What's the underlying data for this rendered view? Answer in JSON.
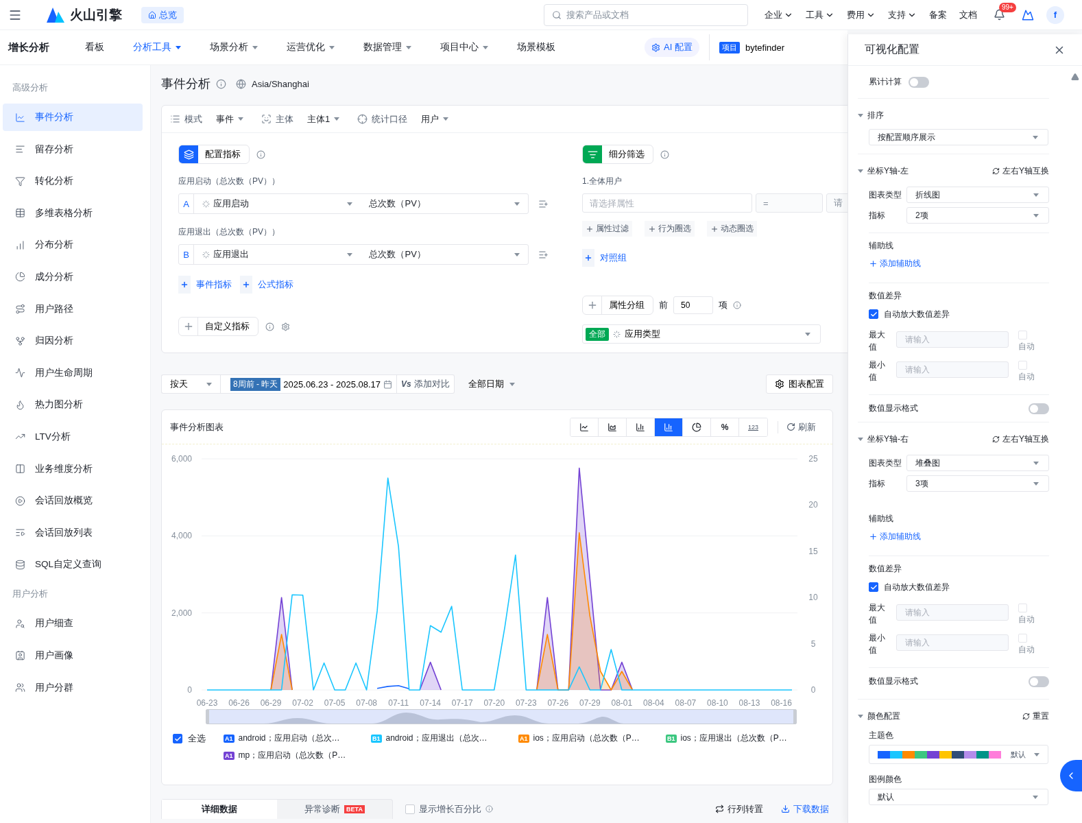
{
  "header": {
    "brand": "火山引擎",
    "home": "总览",
    "search_placeholder": "搜索产品或文档",
    "menus": [
      {
        "label": "企业",
        "has_menu": true
      },
      {
        "label": "工具",
        "has_menu": true
      },
      {
        "label": "费用",
        "has_menu": true
      },
      {
        "label": "支持",
        "has_menu": true
      },
      {
        "label": "备案",
        "has_menu": false
      },
      {
        "label": "文档",
        "has_menu": false
      }
    ],
    "badge": "99+",
    "avatar": "f"
  },
  "nav": {
    "title": "增长分析",
    "items": [
      {
        "label": "看板",
        "has_menu": false,
        "selected": false
      },
      {
        "label": "分析工具",
        "has_menu": true,
        "selected": true
      },
      {
        "label": "场景分析",
        "has_menu": true,
        "selected": false
      },
      {
        "label": "运营优化",
        "has_menu": true,
        "selected": false
      },
      {
        "label": "数据管理",
        "has_menu": true,
        "selected": false
      },
      {
        "label": "项目中心",
        "has_menu": true,
        "selected": false
      },
      {
        "label": "场景模板",
        "has_menu": false,
        "selected": false
      }
    ],
    "ai": "AI 配置",
    "project_tag": "项目",
    "project": "bytefinder"
  },
  "sidebar": {
    "sections": [
      {
        "title": "高级分析",
        "items": [
          {
            "label": "事件分析",
            "selected": true
          },
          {
            "label": "留存分析",
            "selected": false
          },
          {
            "label": "转化分析",
            "selected": false
          },
          {
            "label": "多维表格分析",
            "selected": false
          },
          {
            "label": "分布分析",
            "selected": false
          },
          {
            "label": "成分分析",
            "selected": false
          },
          {
            "label": "用户路径",
            "selected": false
          },
          {
            "label": "归因分析",
            "selected": false
          },
          {
            "label": "用户生命周期",
            "selected": false
          },
          {
            "label": "热力图分析",
            "selected": false
          },
          {
            "label": "LTV分析",
            "selected": false
          },
          {
            "label": "业务维度分析",
            "selected": false
          },
          {
            "label": "会话回放概览",
            "selected": false
          },
          {
            "label": "会话回放列表",
            "selected": false
          },
          {
            "label": "SQL自定义查询",
            "selected": false
          }
        ]
      },
      {
        "title": "用户分析",
        "items": [
          {
            "label": "用户细查",
            "selected": false
          },
          {
            "label": "用户画像",
            "selected": false
          },
          {
            "label": "用户分群",
            "selected": false
          }
        ]
      }
    ]
  },
  "page": {
    "title": "事件分析",
    "timezone": "Asia/Shanghai"
  },
  "query_bar": [
    {
      "label": "模式",
      "value": "事件"
    },
    {
      "label": "主体",
      "value": "主体1"
    },
    {
      "label": "统计口径",
      "value": "用户"
    }
  ],
  "metrics": {
    "title": "配置指标",
    "items": [
      {
        "caption": "应用启动（总次数（PV））",
        "letter": "A",
        "event": "应用启动",
        "measure": "总次数（PV）"
      },
      {
        "caption": "应用退出（总次数（PV））",
        "letter": "B",
        "event": "应用退出",
        "measure": "总次数（PV）"
      }
    ],
    "add_buttons": [
      "事件指标",
      "公式指标"
    ],
    "custom": "自定义指标"
  },
  "filter": {
    "title": "细分筛选",
    "group": "1.全体用户",
    "property_placeholder": "请选择属性",
    "operator": "=",
    "value_cut": "请",
    "actions": [
      "属性过滤",
      "行为圈选",
      "动态圈选"
    ],
    "compare": "对照组",
    "group_by": "属性分组",
    "top_prefix": "前",
    "top_value": "50",
    "top_suffix": "项",
    "tag": "全部",
    "group_value": "应用类型"
  },
  "date_bar": {
    "granularity": "按天",
    "range_tag": "8周前 - 昨天",
    "range": "2025.06.23 - 2025.08.17",
    "compare_mark": "Vs",
    "compare": "添加对比",
    "period": "全部日期",
    "chart_config": "图表配置"
  },
  "chart_card": {
    "title": "事件分析图表",
    "types": [
      {
        "kind": "line",
        "selected": false
      },
      {
        "kind": "area",
        "selected": false
      },
      {
        "kind": "bar",
        "selected": false
      },
      {
        "kind": "combo",
        "selected": true
      },
      {
        "kind": "pie",
        "selected": false
      },
      {
        "kind": "text",
        "label": "%",
        "selected": false
      },
      {
        "kind": "number",
        "label": "123",
        "selected": false
      }
    ],
    "refresh": "刷新",
    "chart_data": {
      "type": "line",
      "categories": [
        "06-23",
        null,
        null,
        "06-26",
        null,
        null,
        "06-29",
        null,
        null,
        "07-02",
        null,
        null,
        "07-05",
        null,
        null,
        "07-08",
        null,
        null,
        "07-11",
        null,
        null,
        "07-14",
        null,
        null,
        "07-17",
        null,
        null,
        "07-20",
        null,
        null,
        "07-23",
        null,
        null,
        "07-26",
        null,
        null,
        "07-29",
        null,
        null,
        "08-01",
        null,
        null,
        "08-04",
        null,
        null,
        "08-07",
        null,
        null,
        "08-10",
        null,
        null,
        "08-13",
        null,
        null,
        "08-16",
        null
      ],
      "ylim": [
        0,
        6000
      ],
      "yticks": [
        {
          "value": 0,
          "label": "0"
        },
        {
          "value": 2000,
          "label": "2,000"
        },
        {
          "value": 4000,
          "label": "4,000"
        },
        {
          "value": 6000,
          "label": "6,000"
        }
      ],
      "y2lim": [
        0,
        25
      ],
      "y2ticks": [
        0,
        5,
        10,
        15,
        20,
        25
      ],
      "series": [
        {
          "name": "android；应用启动（总次…",
          "color": "#1664ff",
          "values": [
            null,
            null,
            null,
            null,
            null,
            null,
            null,
            null,
            null,
            null,
            null,
            null,
            null,
            null,
            null,
            null,
            40,
            90,
            110,
            30,
            null,
            null,
            null,
            null,
            null,
            null,
            null,
            null,
            null,
            null,
            null,
            null,
            null,
            null,
            null,
            null,
            null,
            null,
            null,
            null,
            null,
            null,
            null,
            null,
            null,
            null,
            null,
            null,
            null,
            null,
            null,
            null,
            null,
            null,
            null,
            null
          ]
        },
        {
          "name": "android；应用退出（总次…",
          "color": "#1ac6ff",
          "values": [
            0,
            0,
            0,
            0,
            0,
            0,
            0,
            0,
            2470,
            2460,
            0,
            700,
            0,
            0,
            700,
            0,
            2050,
            5500,
            3720,
            0,
            0,
            1670,
            1500,
            2170,
            0,
            0,
            0,
            0,
            1640,
            3500,
            0,
            0,
            0,
            0,
            0,
            600,
            0,
            0,
            1050,
            0,
            0,
            0,
            0,
            0,
            0,
            0,
            0,
            0,
            0,
            0,
            0,
            0,
            0,
            0,
            0,
            0
          ]
        },
        {
          "name": "ios；应用启动（总次数（P…",
          "color": "#ff8a00",
          "axis": "y2",
          "values": [
            null,
            null,
            null,
            null,
            null,
            null,
            0,
            6,
            0,
            null,
            null,
            null,
            null,
            null,
            null,
            null,
            null,
            null,
            null,
            null,
            null,
            null,
            null,
            null,
            null,
            null,
            null,
            null,
            null,
            null,
            null,
            0,
            6,
            0,
            0,
            17,
            8,
            2,
            0,
            2,
            0,
            null,
            null,
            null,
            null,
            null,
            null,
            null,
            null,
            null,
            null,
            null,
            null,
            null,
            null,
            null
          ]
        },
        {
          "name": "ios；应用退出（总次数（P…",
          "color": "#3cc780",
          "axis": "y2",
          "values": [
            null,
            null,
            null,
            null,
            null,
            null,
            null,
            null,
            null,
            null,
            null,
            null,
            null,
            null,
            null,
            null,
            null,
            null,
            null,
            null,
            null,
            null,
            null,
            null,
            null,
            null,
            null,
            null,
            null,
            null,
            null,
            null,
            null,
            null,
            null,
            null,
            null,
            null,
            null,
            null,
            null,
            null,
            null,
            null,
            null,
            null,
            null,
            null,
            null,
            null,
            null,
            null,
            null,
            null,
            null,
            null
          ]
        },
        {
          "name": "mp；应用启动（总次数（P…",
          "color": "#7442d4",
          "axis": "y2",
          "values": [
            null,
            null,
            null,
            null,
            null,
            null,
            0,
            10,
            0,
            null,
            null,
            null,
            null,
            null,
            null,
            null,
            null,
            null,
            null,
            null,
            0,
            3,
            0,
            null,
            null,
            null,
            null,
            null,
            null,
            null,
            null,
            0,
            10,
            0,
            0,
            24,
            12,
            0,
            0,
            3,
            0,
            null,
            null,
            null,
            null,
            null,
            null,
            null,
            null,
            null,
            null,
            null,
            null,
            null,
            null,
            null
          ]
        }
      ]
    },
    "legend_badges": [
      "A1",
      "B1",
      "A1",
      "B1",
      "A1"
    ],
    "zoom": {
      "level": 1
    },
    "select_all": {
      "label": "全选",
      "checked": true
    }
  },
  "bottom": {
    "tabs": [
      {
        "label": "详细数据",
        "selected": true
      },
      {
        "label": "异常诊断",
        "badge": "BETA",
        "selected": false
      }
    ],
    "growth": {
      "label": "显示增长百分比",
      "checked": false
    },
    "transpose": "行列转置",
    "download": "下载数据"
  },
  "panel": {
    "title": "可视化配置",
    "cumulative": {
      "label": "累计计算",
      "on": false
    },
    "sort": {
      "title": "排序",
      "value": "按配置顺序展示"
    },
    "axes": [
      {
        "title": "坐标Y轴-左",
        "swap": "左右Y轴互换",
        "type_label": "图表类型",
        "type": "折线图",
        "metric_label": "指标",
        "metric": "2项",
        "guide_title": "辅助线",
        "guide_add": "添加辅助线",
        "diff_title": "数值差异",
        "amplify": {
          "label": "自动放大数值差异",
          "checked": true
        },
        "limits": [
          {
            "label": "最大值",
            "placeholder": "请输入",
            "auto_label": "自动",
            "auto": false
          },
          {
            "label": "最小值",
            "placeholder": "请输入",
            "auto_label": "自动",
            "auto": false
          }
        ],
        "format": {
          "label": "数值显示格式",
          "on": false
        }
      },
      {
        "title": "坐标Y轴-右",
        "swap": "左右Y轴互换",
        "type_label": "图表类型",
        "type": "堆叠图",
        "metric_label": "指标",
        "metric": "3项",
        "guide_title": "辅助线",
        "guide_add": "添加辅助线",
        "diff_title": "数值差异",
        "amplify": {
          "label": "自动放大数值差异",
          "checked": true
        },
        "limits": [
          {
            "label": "最大值",
            "placeholder": "请输入",
            "auto_label": "自动",
            "auto": false
          },
          {
            "label": "最小值",
            "placeholder": "请输入",
            "auto_label": "自动",
            "auto": false
          }
        ],
        "format": {
          "label": "数值显示格式",
          "on": false
        }
      }
    ],
    "colors": {
      "title": "颜色配置",
      "reset": "重置",
      "theme_label": "主题色",
      "palette": [
        {
          "color": "#1664ff"
        },
        {
          "color": "#1ac6ff"
        },
        {
          "color": "#ff8a00"
        },
        {
          "color": "#3cc780"
        },
        {
          "color": "#7442d4"
        },
        {
          "color": "#ffc400"
        },
        {
          "color": "#304d77"
        },
        {
          "color": "#b48deb"
        },
        {
          "color": "#009488"
        },
        {
          "color": "#ff7dda"
        }
      ],
      "palette_name": "默认",
      "legend_label": "图例颜色",
      "legend_value": "默认"
    }
  }
}
